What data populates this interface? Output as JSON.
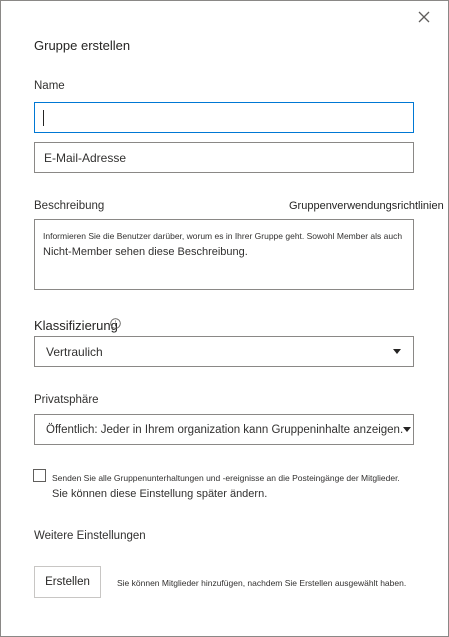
{
  "dialog": {
    "title": "Gruppe erstellen",
    "name_label": "Name",
    "name_value": "",
    "email_placeholder": "E-Mail-Adresse",
    "description_label": "Beschreibung",
    "guidelines_link": "Gruppenverwendungsrichtlinien",
    "description_hint_line1": "Informieren Sie die Benutzer darüber, worum es in Ihrer Gruppe geht. Sowohl Member als auch",
    "description_hint_line2": "Nicht-Member sehen diese Beschreibung.",
    "classification_label": "Klassifizierung",
    "classification_value": "Vertraulich",
    "privacy_label": "Privatsphäre",
    "privacy_value": "Öffentlich: Jeder in Ihrem organization kann Gruppeninhalte anzeigen.",
    "subscribe_checked": false,
    "subscribe_line1": "Senden Sie alle Gruppenunterhaltungen und -ereignisse an die Posteingänge der Mitglieder.",
    "subscribe_line2": "Sie können diese Einstellung später ändern.",
    "more_settings": "Weitere Einstellungen",
    "create_button": "Erstellen",
    "create_hint": "Sie können Mitglieder hinzufügen, nachdem Sie Erstellen ausgewählt haben."
  },
  "icons": {
    "close": "close-icon",
    "info": "info-icon",
    "dropdown": "chevron-down-icon"
  },
  "colors": {
    "focus_border": "#0078d4",
    "field_border": "#8a8886",
    "text": "#252423"
  }
}
